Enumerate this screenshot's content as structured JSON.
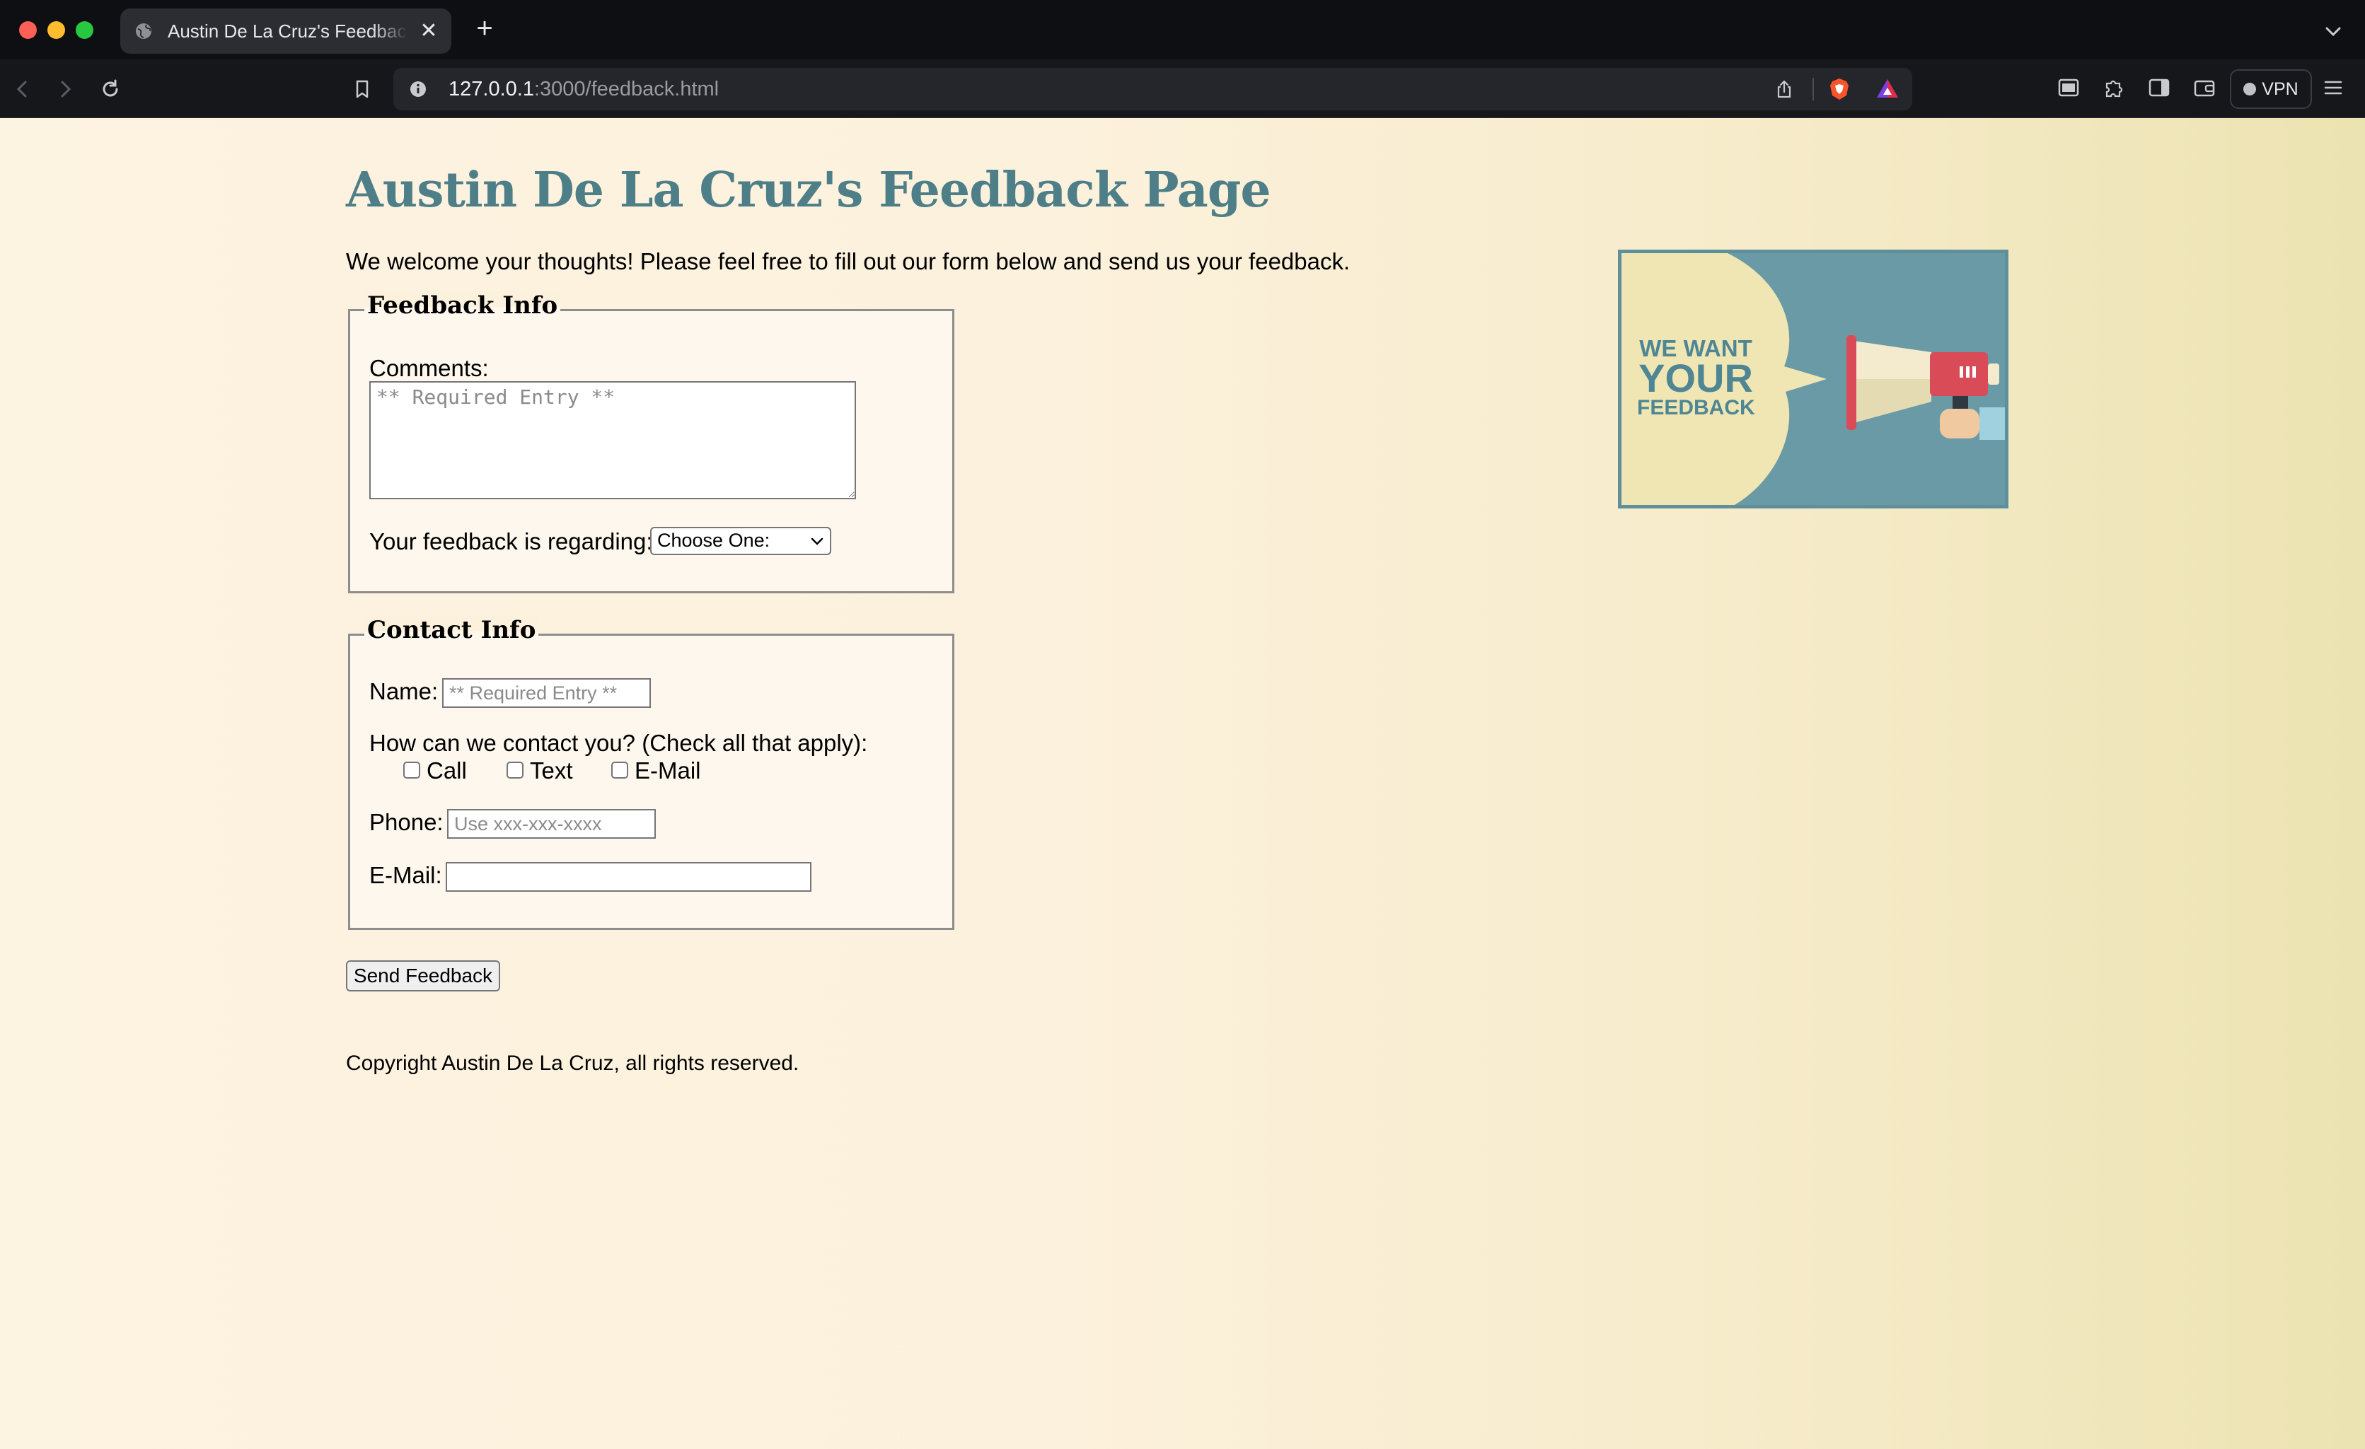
{
  "browser": {
    "tab_title": "Austin De La Cruz's Feedback Page",
    "tab_close": "✕",
    "new_tab": "+",
    "url_host": "127.0.0.1",
    "url_rest": ":3000/feedback.html",
    "vpn_label": "VPN"
  },
  "page": {
    "heading": "Austin De La Cruz's Feedback Page",
    "intro": "We welcome your thoughts! Please feel free to fill out our form below and send us your feedback.",
    "hero": {
      "line1": "WE WANT",
      "line2": "YOUR",
      "line3": "FEEDBACK"
    },
    "feedback_info": {
      "legend": "Feedback Info",
      "comments_label": "Comments:",
      "comments_placeholder": "** Required Entry **",
      "regarding_label": "Your feedback is regarding:",
      "regarding_selected": "Choose One:"
    },
    "contact_info": {
      "legend": "Contact Info",
      "name_label": "Name:",
      "name_placeholder": "** Required Entry **",
      "contact_question": "How can we contact you? (Check all that apply):",
      "options": [
        "Call",
        "Text",
        "E-Mail"
      ],
      "phone_label": "Phone:",
      "phone_placeholder": "Use xxx-xxx-xxxx",
      "email_label": "E-Mail:",
      "email_value": ""
    },
    "send_button": "Send Feedback",
    "copyright": "Copyright Austin De La Cruz, all rights reserved."
  },
  "colors": {
    "heading": "#4e7f89",
    "page_bg_left": "#fdf3e1",
    "page_bg_right": "#ece3b2",
    "hero_bg": "#6a9aa6"
  }
}
